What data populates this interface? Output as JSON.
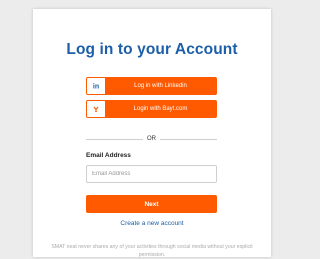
{
  "login": {
    "title": "Log in to your Account",
    "linkedin_label": "Log in with Linkedin",
    "bayt_label": "Login with Bayt.com",
    "or_text": "OR",
    "email_label": "Email Address",
    "email_placeholder": "Email Address",
    "email_value": "",
    "next_label": "Next",
    "create_account_label": "Create a new account",
    "disclaimer": "SMAT neat never shares any of your activities through social media without your explicit permission."
  },
  "icons": {
    "linkedin": "linkedin-icon",
    "bayt": "bayt-icon"
  },
  "colors": {
    "accent": "#ff5a00",
    "title": "#1c5fa8",
    "link": "#1c5fa8",
    "background": "#ececec"
  }
}
